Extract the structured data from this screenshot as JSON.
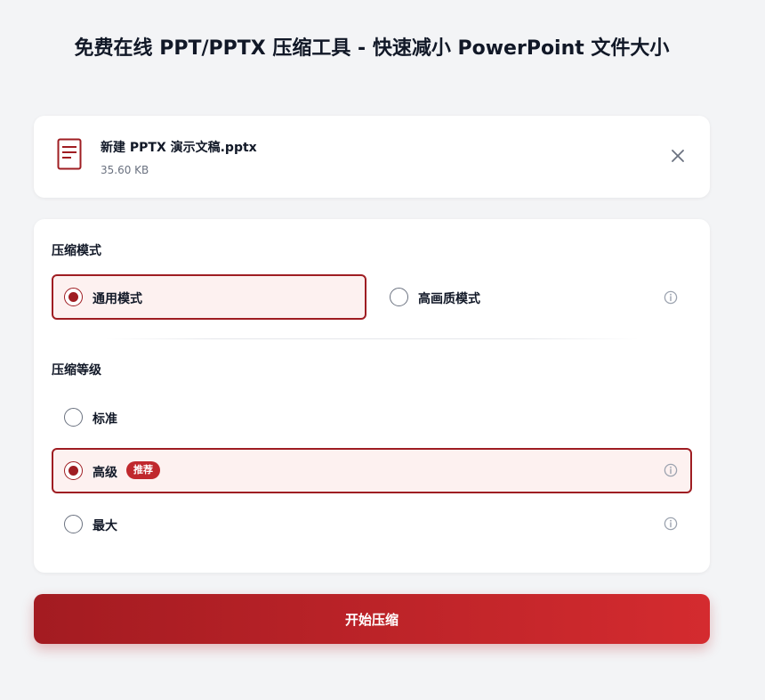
{
  "header": {
    "title": "免费在线 PPT/PPTX 压缩工具 - 快速减小 PowerPoint 文件大小"
  },
  "file": {
    "name": "新建 PPTX 演示文稿.pptx",
    "size": "35.60 KB"
  },
  "compression_mode": {
    "title": "压缩模式",
    "options": [
      {
        "label": "通用模式",
        "selected": true
      },
      {
        "label": "高画质模式",
        "selected": false
      }
    ]
  },
  "compression_level": {
    "title": "压缩等级",
    "options": [
      {
        "label": "标准",
        "selected": false
      },
      {
        "label": "高级",
        "selected": true,
        "badge": "推荐"
      },
      {
        "label": "最大",
        "selected": false
      }
    ]
  },
  "actions": {
    "start_label": "开始压缩"
  },
  "colors": {
    "accent": "#9f1d22",
    "accent_bg": "#fdf1f0",
    "badge": "#c0282d"
  }
}
